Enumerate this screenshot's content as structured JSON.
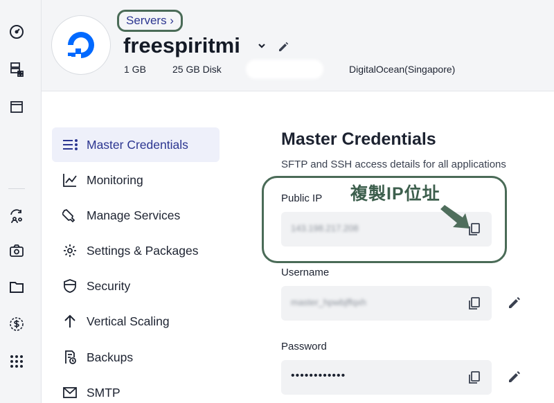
{
  "breadcrumb": {
    "label": "Servers ›"
  },
  "server": {
    "name": "freespiritmi",
    "ram": "1 GB",
    "disk": "25 GB Disk",
    "provider": "DigitalOcean(Singapore)"
  },
  "nav": {
    "items": [
      {
        "label": "Master Credentials",
        "icon": "list-icon",
        "active": true
      },
      {
        "label": "Monitoring",
        "icon": "chart-line-icon"
      },
      {
        "label": "Manage Services",
        "icon": "wrench-icon"
      },
      {
        "label": "Settings & Packages",
        "icon": "gear-icon"
      },
      {
        "label": "Security",
        "icon": "shield-icon"
      },
      {
        "label": "Vertical Scaling",
        "icon": "arrow-up-icon"
      },
      {
        "label": "Backups",
        "icon": "backup-icon"
      },
      {
        "label": "SMTP",
        "icon": "mail-icon"
      }
    ]
  },
  "main": {
    "title": "Master Credentials",
    "subtitle": "SFTP and SSH access details for all applications",
    "public_ip": {
      "label": "Public IP",
      "value": "143.198.217.208"
    },
    "username": {
      "label": "Username",
      "value": "master_hpwbjffqxh"
    },
    "password": {
      "label": "Password",
      "value": "••••••••••••"
    }
  },
  "annotation": {
    "text": "複製IP位址",
    "color": "#3d5f4d"
  },
  "colors": {
    "accent": "#2b3590",
    "annotation_frame": "#4a6b57",
    "brand": "#0069ff"
  }
}
